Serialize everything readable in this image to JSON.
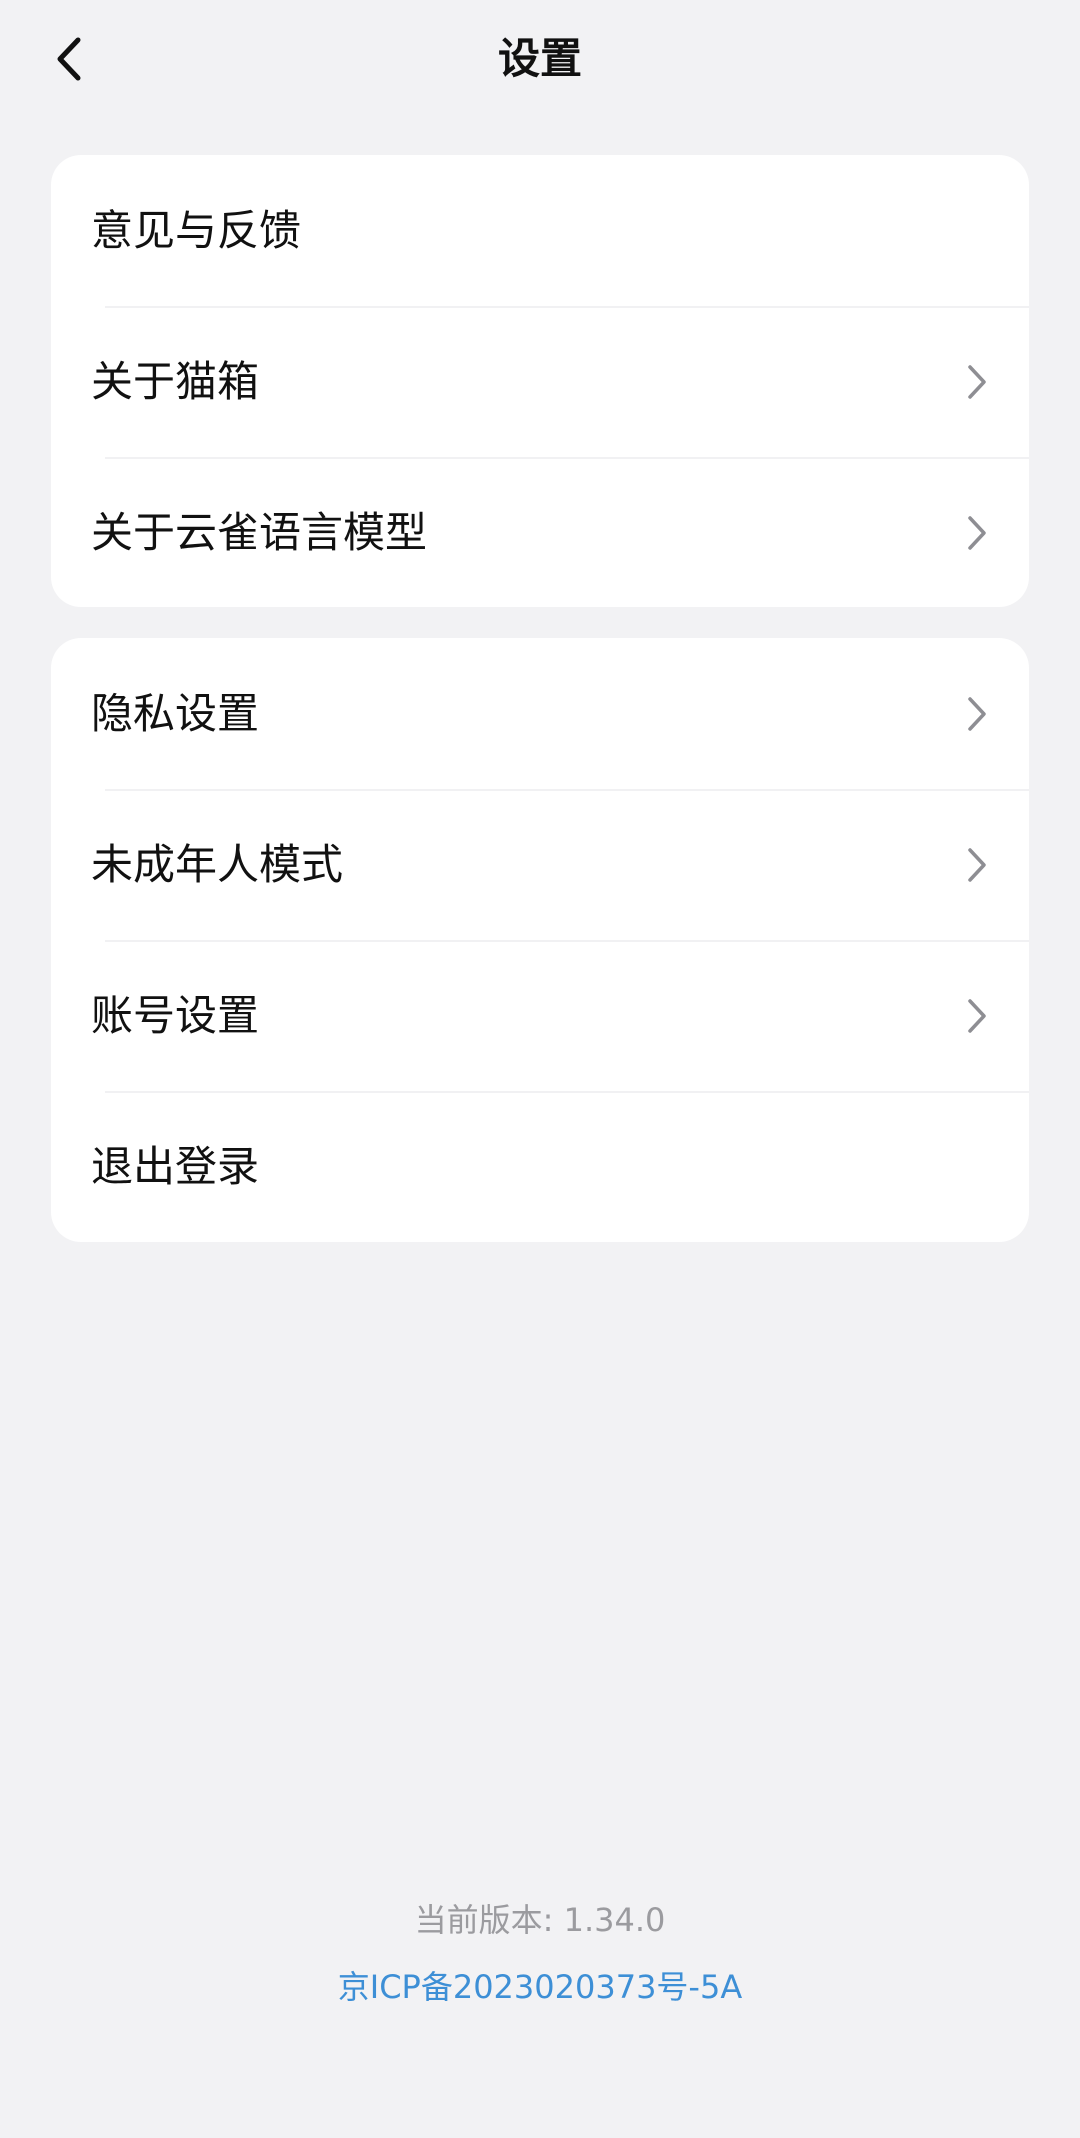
{
  "header": {
    "back_icon": "chevron-left-icon",
    "title": "设置"
  },
  "groups": [
    {
      "items": [
        {
          "label": "意见与反馈",
          "has_chevron": false
        },
        {
          "label": "关于猫箱",
          "has_chevron": true
        },
        {
          "label": "关于云雀语言模型",
          "has_chevron": true
        }
      ]
    },
    {
      "items": [
        {
          "label": "隐私设置",
          "has_chevron": true
        },
        {
          "label": "未成年人模式",
          "has_chevron": true
        },
        {
          "label": "账号设置",
          "has_chevron": true
        },
        {
          "label": "退出登录",
          "has_chevron": false
        }
      ]
    }
  ],
  "footer": {
    "version_text": "当前版本: 1.34.0",
    "icp_text": "京ICP备2023020373号-5A"
  },
  "colors": {
    "background": "#f2f2f4",
    "card": "#ffffff",
    "chevron": "#8e8e93",
    "footer_gray": "#9b9b9f",
    "link_blue": "#3d8fd6"
  }
}
